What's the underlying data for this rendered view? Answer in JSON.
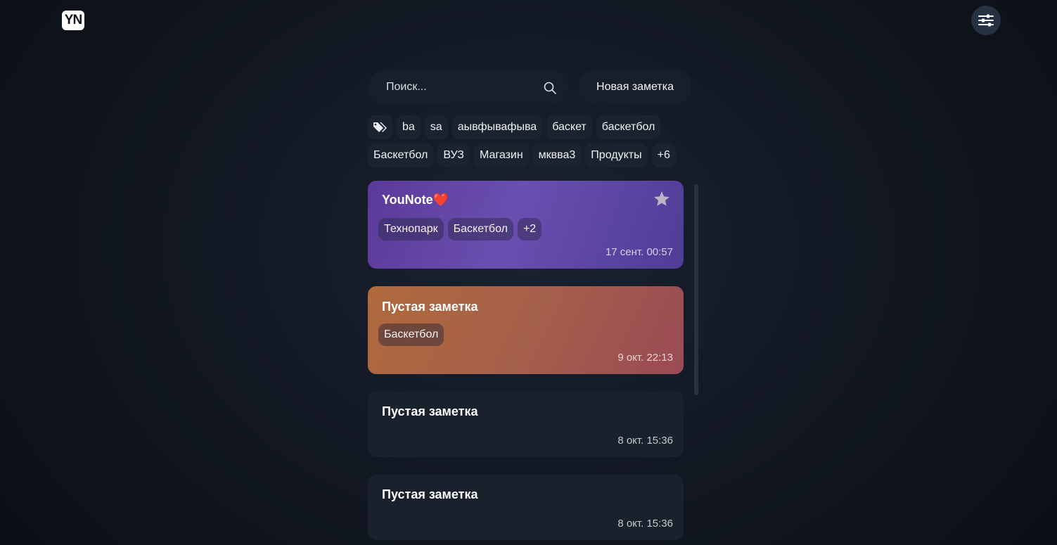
{
  "header": {
    "logo_text": "YN",
    "settings_icon": "sliders-icon"
  },
  "search": {
    "placeholder": "Поиск...",
    "value": "",
    "icon": "search-icon"
  },
  "new_note_label": "Новая заметка",
  "tags": {
    "icon": "tags-icon",
    "row1": [
      "ba",
      "sa",
      "аывфывафыва",
      "баскет",
      "баскетбол"
    ],
    "row2": [
      "Баскетбол",
      "ВУЗ",
      "Магазин",
      "мквва3",
      "Продукты"
    ],
    "more": "+6"
  },
  "notes": [
    {
      "title": "YouNote",
      "emoji": "❤️",
      "favorite_icon": "star-icon",
      "tags": [
        "Технопарк",
        "Баскетбол"
      ],
      "more": "+2",
      "date": "17 сент. 00:57",
      "color": "#6a4fb0"
    },
    {
      "title": "Пустая заметка",
      "tags": [
        "Баскетбол"
      ],
      "date": "9 окт. 22:13",
      "color": "#a5604a"
    },
    {
      "title": "Пустая заметка",
      "date": "8 окт. 15:36",
      "color": "#18212c"
    },
    {
      "title": "Пустая заметка",
      "date": "8 окт. 15:36",
      "color": "#18212c"
    }
  ]
}
